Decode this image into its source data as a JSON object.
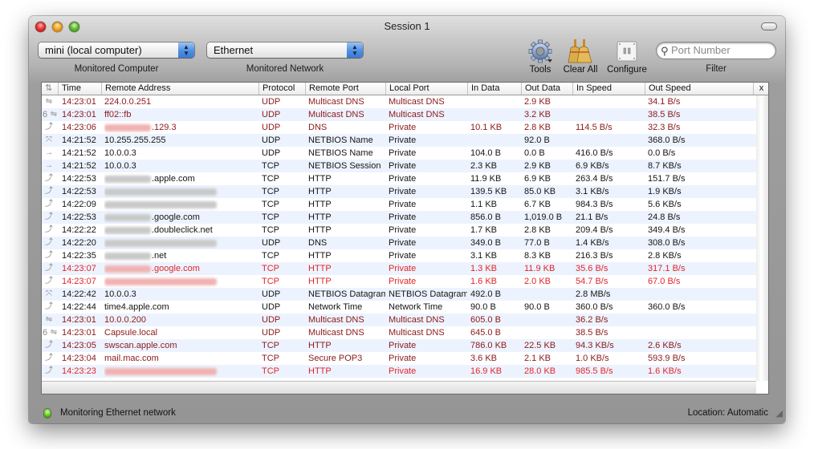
{
  "window": {
    "title": "Session 1"
  },
  "toolbar": {
    "computer_popup": {
      "value": "mini (local computer)",
      "label": "Monitored Computer"
    },
    "network_popup": {
      "value": "Ethernet",
      "label": "Monitored Network"
    },
    "tools_label": "Tools",
    "clear_all_label": "Clear All",
    "configure_label": "Configure",
    "filter": {
      "placeholder": "Port Number",
      "value": "",
      "label": "Filter"
    }
  },
  "table": {
    "columns": [
      "Time",
      "Remote Address",
      "Protocol",
      "Remote Port",
      "Local Port",
      "In Data",
      "Out Data",
      "In Speed",
      "Out Speed"
    ],
    "close_column_label": "x",
    "rows": [
      {
        "icon": "multicast",
        "ipv6": false,
        "color": "dark",
        "time": "14:23:01",
        "address": "224.0.0.251",
        "redacted_prefix": false,
        "protocol": "UDP",
        "remote_port": "Multicast DNS",
        "local_port": "Multicast DNS",
        "in_data": "",
        "out_data": "2.9 KB",
        "in_speed": "",
        "out_speed": "34.1 B/s"
      },
      {
        "icon": "multicast",
        "ipv6": true,
        "color": "dark",
        "time": "14:23:01",
        "address": "ff02::fb",
        "redacted_prefix": false,
        "protocol": "UDP",
        "remote_port": "Multicast DNS",
        "local_port": "Multicast DNS",
        "in_data": "",
        "out_data": "3.2 KB",
        "in_speed": "",
        "out_speed": "38.5 B/s"
      },
      {
        "icon": "outgoing",
        "ipv6": false,
        "color": "dark",
        "time": "14:23:06",
        "address": ".129.3",
        "redacted_prefix": true,
        "protocol": "UDP",
        "remote_port": "DNS",
        "local_port": "Private",
        "in_data": "10.1 KB",
        "out_data": "2.8 KB",
        "in_speed": "114.5 B/s",
        "out_speed": "32.3 B/s"
      },
      {
        "icon": "broadcast",
        "ipv6": false,
        "color": "normal",
        "time": "14:21:52",
        "address": "10.255.255.255",
        "redacted_prefix": false,
        "protocol": "UDP",
        "remote_port": "NETBIOS Name",
        "local_port": "Private",
        "in_data": "",
        "out_data": "92.0 B",
        "in_speed": "",
        "out_speed": "368.0 B/s"
      },
      {
        "icon": "arrow-right",
        "ipv6": false,
        "color": "normal",
        "time": "14:21:52",
        "address": "10.0.0.3",
        "redacted_prefix": false,
        "protocol": "UDP",
        "remote_port": "NETBIOS Name",
        "local_port": "Private",
        "in_data": "104.0 B",
        "out_data": "0.0 B",
        "in_speed": "416.0 B/s",
        "out_speed": "0.0 B/s"
      },
      {
        "icon": "arrow-right",
        "ipv6": false,
        "color": "normal",
        "time": "14:21:52",
        "address": "10.0.0.3",
        "redacted_prefix": false,
        "protocol": "TCP",
        "remote_port": "NETBIOS Session",
        "local_port": "Private",
        "in_data": "2.3 KB",
        "out_data": "2.9 KB",
        "in_speed": "6.9 KB/s",
        "out_speed": "8.7 KB/s"
      },
      {
        "icon": "outgoing",
        "ipv6": false,
        "color": "normal",
        "time": "14:22:53",
        "address": ".apple.com",
        "redacted_prefix": true,
        "protocol": "TCP",
        "remote_port": "HTTP",
        "local_port": "Private",
        "in_data": "11.9 KB",
        "out_data": "6.9 KB",
        "in_speed": "263.4 B/s",
        "out_speed": "151.7 B/s"
      },
      {
        "icon": "outgoing",
        "ipv6": false,
        "color": "normal",
        "time": "14:22:53",
        "address": "",
        "redacted_prefix": true,
        "protocol": "TCP",
        "remote_port": "HTTP",
        "local_port": "Private",
        "in_data": "139.5 KB",
        "out_data": "85.0 KB",
        "in_speed": "3.1 KB/s",
        "out_speed": "1.9 KB/s"
      },
      {
        "icon": "outgoing",
        "ipv6": false,
        "color": "normal",
        "time": "14:22:09",
        "address": "",
        "redacted_prefix": true,
        "protocol": "TCP",
        "remote_port": "HTTP",
        "local_port": "Private",
        "in_data": "1.1 KB",
        "out_data": "6.7 KB",
        "in_speed": "984.3 B/s",
        "out_speed": "5.6 KB/s"
      },
      {
        "icon": "outgoing",
        "ipv6": false,
        "color": "normal",
        "time": "14:22:53",
        "address": ".google.com",
        "redacted_prefix": true,
        "protocol": "TCP",
        "remote_port": "HTTP",
        "local_port": "Private",
        "in_data": "856.0 B",
        "out_data": "1,019.0 B",
        "in_speed": "21.1 B/s",
        "out_speed": "24.8 B/s"
      },
      {
        "icon": "outgoing",
        "ipv6": false,
        "color": "normal",
        "time": "14:22:22",
        "address": ".doubleclick.net",
        "redacted_prefix": true,
        "protocol": "TCP",
        "remote_port": "HTTP",
        "local_port": "Private",
        "in_data": "1.7 KB",
        "out_data": "2.8 KB",
        "in_speed": "209.4 B/s",
        "out_speed": "349.4 B/s"
      },
      {
        "icon": "outgoing",
        "ipv6": false,
        "color": "normal",
        "time": "14:22:20",
        "address": "",
        "redacted_prefix": true,
        "protocol": "UDP",
        "remote_port": "DNS",
        "local_port": "Private",
        "in_data": "349.0 B",
        "out_data": "77.0 B",
        "in_speed": "1.4 KB/s",
        "out_speed": "308.0 B/s"
      },
      {
        "icon": "outgoing",
        "ipv6": false,
        "color": "normal",
        "time": "14:22:35",
        "address": ".net",
        "redacted_prefix": true,
        "protocol": "TCP",
        "remote_port": "HTTP",
        "local_port": "Private",
        "in_data": "3.1 KB",
        "out_data": "8.3 KB",
        "in_speed": "216.3 B/s",
        "out_speed": "2.8 KB/s"
      },
      {
        "icon": "outgoing",
        "ipv6": false,
        "color": "bright",
        "time": "14:23:07",
        "address": ".google.com",
        "redacted_prefix": true,
        "protocol": "TCP",
        "remote_port": "HTTP",
        "local_port": "Private",
        "in_data": "1.3 KB",
        "out_data": "11.9 KB",
        "in_speed": "35.6 B/s",
        "out_speed": "317.1 B/s"
      },
      {
        "icon": "outgoing",
        "ipv6": false,
        "color": "bright",
        "time": "14:23:07",
        "address": "",
        "redacted_prefix": true,
        "protocol": "TCP",
        "remote_port": "HTTP",
        "local_port": "Private",
        "in_data": "1.6 KB",
        "out_data": "2.0 KB",
        "in_speed": "54.7 B/s",
        "out_speed": "67.0 B/s"
      },
      {
        "icon": "broadcast",
        "ipv6": false,
        "color": "normal",
        "time": "14:22:42",
        "address": "10.0.0.3",
        "redacted_prefix": false,
        "protocol": "UDP",
        "remote_port": "NETBIOS Datagram",
        "local_port": "NETBIOS Datagram",
        "in_data": "492.0 B",
        "out_data": "",
        "in_speed": "2.8 MB/s",
        "out_speed": ""
      },
      {
        "icon": "outgoing",
        "ipv6": false,
        "color": "normal",
        "time": "14:22:44",
        "address": "time4.apple.com",
        "redacted_prefix": false,
        "protocol": "UDP",
        "remote_port": "Network Time",
        "local_port": "Network Time",
        "in_data": "90.0 B",
        "out_data": "90.0 B",
        "in_speed": "360.0 B/s",
        "out_speed": "360.0 B/s"
      },
      {
        "icon": "multicast",
        "ipv6": false,
        "color": "dark",
        "time": "14:23:01",
        "address": "10.0.0.200",
        "redacted_prefix": false,
        "protocol": "UDP",
        "remote_port": "Multicast DNS",
        "local_port": "Multicast DNS",
        "in_data": "605.0 B",
        "out_data": "",
        "in_speed": "36.2 B/s",
        "out_speed": ""
      },
      {
        "icon": "multicast",
        "ipv6": true,
        "color": "dark",
        "time": "14:23:01",
        "address": "Capsule.local",
        "redacted_prefix": false,
        "protocol": "UDP",
        "remote_port": "Multicast DNS",
        "local_port": "Multicast DNS",
        "in_data": "645.0 B",
        "out_data": "",
        "in_speed": "38.5 B/s",
        "out_speed": ""
      },
      {
        "icon": "outgoing",
        "ipv6": false,
        "color": "dark",
        "time": "14:23:05",
        "address": "swscan.apple.com",
        "redacted_prefix": false,
        "protocol": "TCP",
        "remote_port": "HTTP",
        "local_port": "Private",
        "in_data": "786.0 KB",
        "out_data": "22.5 KB",
        "in_speed": "94.3 KB/s",
        "out_speed": "2.6 KB/s"
      },
      {
        "icon": "outgoing",
        "ipv6": false,
        "color": "dark",
        "time": "14:23:04",
        "address": "mail.mac.com",
        "redacted_prefix": false,
        "protocol": "TCP",
        "remote_port": "Secure POP3",
        "local_port": "Private",
        "in_data": "3.6 KB",
        "out_data": "2.1 KB",
        "in_speed": "1.0 KB/s",
        "out_speed": "593.9 B/s"
      },
      {
        "icon": "outgoing",
        "ipv6": false,
        "color": "bright",
        "time": "14:23:23",
        "address": "",
        "redacted_prefix": true,
        "protocol": "TCP",
        "remote_port": "HTTP",
        "local_port": "Private",
        "in_data": "16.9 KB",
        "out_data": "28.0 KB",
        "in_speed": "985.5 B/s",
        "out_speed": "1.6 KB/s"
      }
    ]
  },
  "status_bar": {
    "status_text": "Monitoring Ethernet network",
    "location_text": "Location: Automatic"
  },
  "colors": {
    "row_dark_red": "#8a1a1a",
    "row_bright_red": "#e0262a",
    "row_normal": "#151515",
    "row_alt_bg": "#edf3fe",
    "status_led": "#53c20c"
  }
}
